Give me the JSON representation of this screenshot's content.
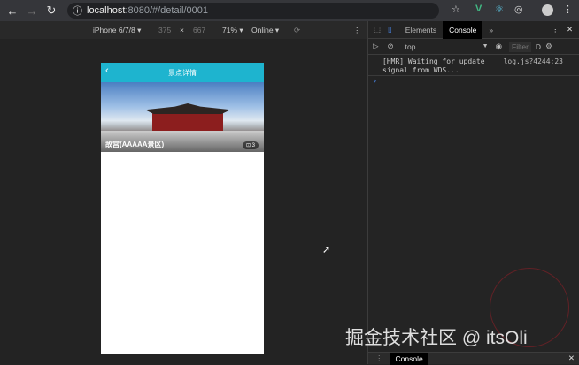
{
  "browser": {
    "url_host": "localhost",
    "url_rest": ":8080/#/detail/0001"
  },
  "device_toolbar": {
    "device": "iPhone 6/7/8 ▾",
    "width": "375",
    "x": "×",
    "height": "667",
    "zoom": "71% ▾",
    "network": "Online ▾"
  },
  "page": {
    "header_title": "景点详情",
    "back": "‹",
    "place_title": "故宫(AAAAA景区)",
    "photo_count": "⊡ 3"
  },
  "devtools": {
    "tabs": [
      "Elements",
      "Console"
    ],
    "more": "»",
    "context": "top",
    "filter_placeholder": "Filter",
    "levels": "D",
    "log": {
      "message_line1": "[HMR] Waiting for update",
      "message_line2": "signal from WDS...",
      "source": "log.js?4244:23"
    },
    "prompt": "›",
    "drawer_tab": "Console"
  },
  "watermark": "掘金技术社区 @ itsOli"
}
